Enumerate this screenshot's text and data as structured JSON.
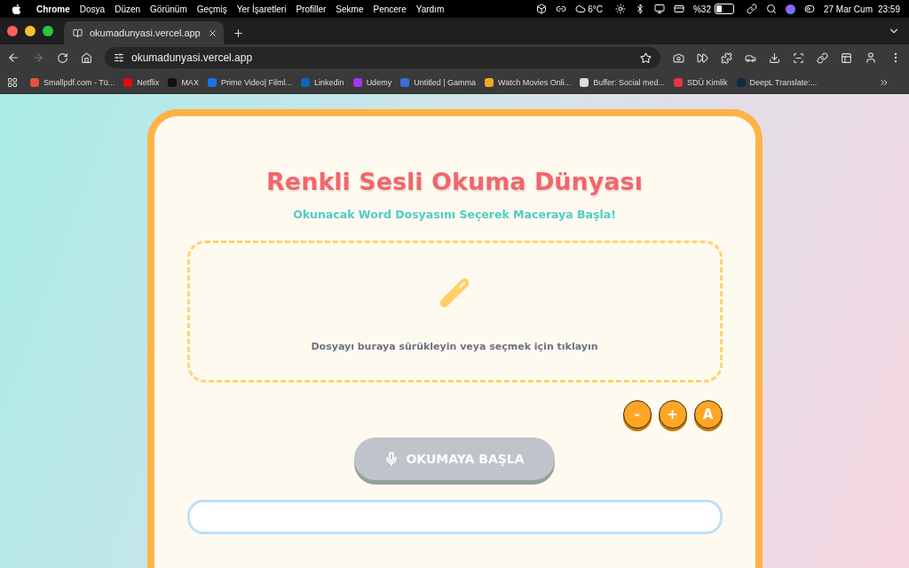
{
  "menu_bar": {
    "app_name": "Chrome",
    "items": [
      "Dosya",
      "Düzen",
      "Görünüm",
      "Geçmiş",
      "Yer İşaretleri",
      "Profiller",
      "Sekme",
      "Pencere",
      "Yardım"
    ],
    "weather": "6°C",
    "battery": {
      "reading": "%32",
      "level": 0.32
    },
    "date": "27 Mar Cum",
    "time": "23:59"
  },
  "tabs": [
    {
      "title": "okumadunyasi.vercel.app",
      "selected": true
    }
  ],
  "toolbar": {
    "address": "okumadunyasi.vercel.app",
    "forward_disabled": true
  },
  "bookmarks": [
    {
      "label": "Smallpdf.com - Tü...",
      "color": "#e8513c"
    },
    {
      "label": "Netflix",
      "color": "#e50914"
    },
    {
      "label": "MAX",
      "color": "#111111"
    },
    {
      "label": "Prime Video| Filml...",
      "color": "#1a73e8"
    },
    {
      "label": "Linkedin",
      "color": "#0a66c2"
    },
    {
      "label": "Udemy",
      "color": "#a435f0"
    },
    {
      "label": "Untitled | Gamma",
      "color": "#3b6fd8"
    },
    {
      "label": "Watch Movies Onli...",
      "color": "#f5a623"
    },
    {
      "label": "Buffer: Social med...",
      "color": "#dddddd"
    },
    {
      "label": "SDÜ Kimlik",
      "color": "#e8334a"
    },
    {
      "label": "DeepL Translate:...",
      "color": "#0f2b46"
    }
  ],
  "page": {
    "title": "Renkli Sesli Okuma Dünyası",
    "subtitle": "Okunacak Word Dosyasını Seçerek Maceraya Başla!",
    "drop_zone": {
      "text": "Dosyayı buraya sürükleyin veya seçmek için tıklayın"
    },
    "font_buttons": [
      "-",
      "+",
      "A"
    ],
    "start_button": {
      "label": "OKUMAYA BAŞLA",
      "disabled": true
    }
  }
}
